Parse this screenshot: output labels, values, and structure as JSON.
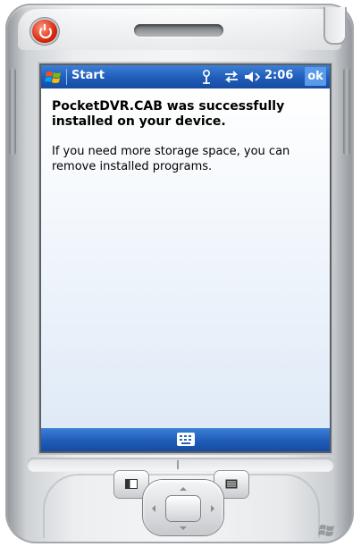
{
  "device": {
    "accent_color": "#1f5cb8"
  },
  "titlebar": {
    "title": "Start",
    "time": "2:06",
    "ok_label": "ok",
    "icons": [
      "start-flag-icon",
      "antenna-icon",
      "connectivity-icon",
      "volume-icon"
    ]
  },
  "message": {
    "heading": "PocketDVR.CAB was successfully installed on your device.",
    "body": "If you need more storage space, you can remove installed programs."
  },
  "menubar": {
    "icons": [
      "keyboard-icon"
    ]
  }
}
